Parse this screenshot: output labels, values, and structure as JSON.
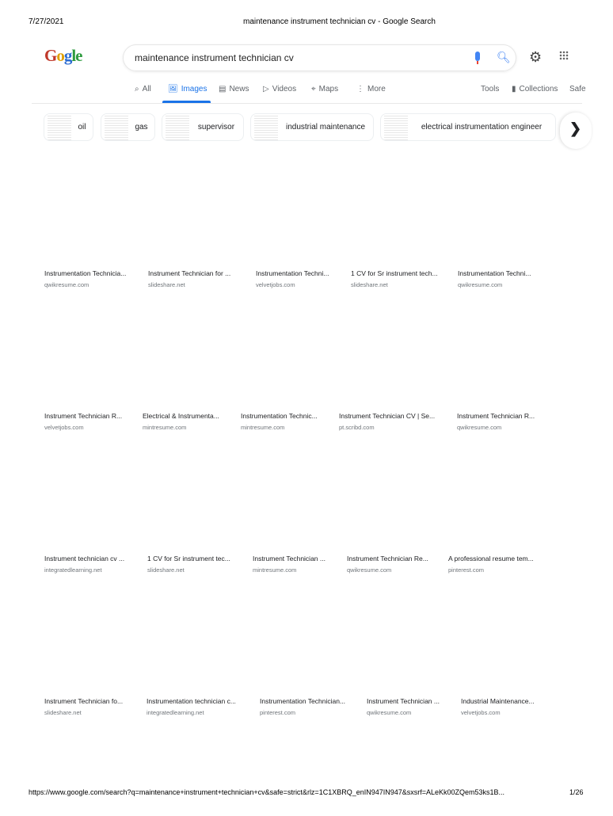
{
  "print_header": {
    "date": "7/27/2021",
    "title": "maintenance instrument technician cv - Google Search"
  },
  "logo": {
    "letters": [
      "G",
      "o",
      "g",
      "le"
    ],
    "text": "Google"
  },
  "search": {
    "value": "maintenance instrument technician cv"
  },
  "tabs": [
    {
      "label": "All",
      "icon": "search-icon"
    },
    {
      "label": "Images",
      "icon": "image-icon",
      "active": true
    },
    {
      "label": "News",
      "icon": "news-icon"
    },
    {
      "label": "Videos",
      "icon": "video-icon"
    },
    {
      "label": "Maps",
      "icon": "map-pin-icon"
    },
    {
      "label": "More",
      "icon": "more-vert-icon"
    }
  ],
  "tools": {
    "tools": "Tools",
    "collections": "Collections",
    "safe": "Safe"
  },
  "chips": [
    "oil",
    "gas",
    "supervisor",
    "industrial maintenance",
    "electrical instrumentation engineer"
  ],
  "results": [
    [
      {
        "title": "Instrumentation Technicia...",
        "source": "qwikresume.com"
      },
      {
        "title": "Instrument Technician for ...",
        "source": "slideshare.net"
      },
      {
        "title": "Instrumentation Techni...",
        "source": "velvetjobs.com"
      },
      {
        "title": "1 CV for Sr instrument tech...",
        "source": "slideshare.net"
      },
      {
        "title": "Instrumentation Techni...",
        "source": "qwikresume.com"
      }
    ],
    [
      {
        "title": "Instrument Technician R...",
        "source": "velvetjobs.com"
      },
      {
        "title": "Electrical & Instrumenta...",
        "source": "mintresume.com"
      },
      {
        "title": "Instrumentation Technic...",
        "source": "mintresume.com"
      },
      {
        "title": "Instrument Technician CV | Se...",
        "source": "pt.scribd.com"
      },
      {
        "title": "Instrument Technician R...",
        "source": "qwikresume.com"
      }
    ],
    [
      {
        "title": "Instrument technician cv ...",
        "source": "integratedlearning.net"
      },
      {
        "title": "1 CV for Sr instrument tec...",
        "source": "slideshare.net"
      },
      {
        "title": "Instrument Technician ...",
        "source": "mintresume.com"
      },
      {
        "title": "Instrument Technician Re...",
        "source": "qwikresume.com"
      },
      {
        "title": "A professional resume tem...",
        "source": "pinterest.com"
      }
    ],
    [
      {
        "title": "Instrument Technician fo...",
        "source": "slideshare.net"
      },
      {
        "title": "Instrumentation technician c...",
        "source": "integratedlearning.net"
      },
      {
        "title": "Instrumentation Technician...",
        "source": "pinterest.com"
      },
      {
        "title": "Instrument Technician ...",
        "source": "qwikresume.com"
      },
      {
        "title": "Industrial Maintenance...",
        "source": "velvetjobs.com"
      }
    ]
  ],
  "footer": {
    "url": "https://www.google.com/search?q=maintenance+instrument+technician+cv&safe=strict&rlz=1C1XBRQ_enIN947IN947&sxsrf=ALeKk00ZQem53ks1B...",
    "page": "1/26"
  }
}
